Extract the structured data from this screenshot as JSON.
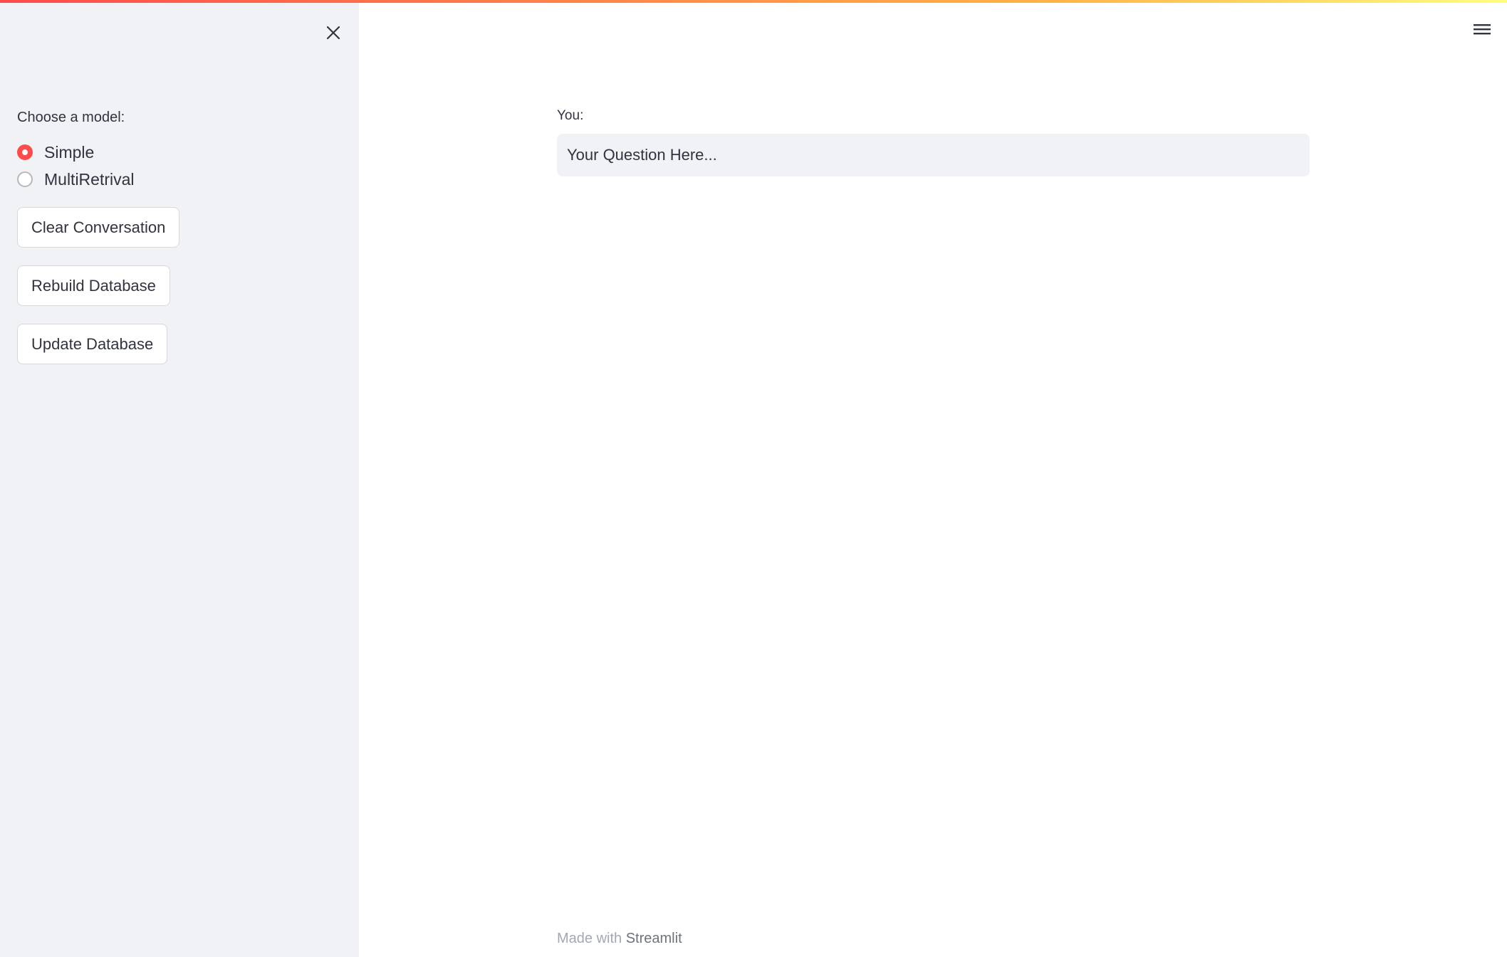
{
  "sidebar": {
    "model_label": "Choose a model:",
    "model_options": [
      {
        "label": "Simple",
        "selected": true
      },
      {
        "label": "MultiRetrival",
        "selected": false
      }
    ],
    "buttons": {
      "clear": "Clear Conversation",
      "rebuild": "Rebuild Database",
      "update": "Update Database"
    },
    "close_icon": "close-icon"
  },
  "header": {
    "menu_icon": "hamburger-menu-icon"
  },
  "main": {
    "input_label": "You:",
    "input_placeholder": "Your Question Here...",
    "input_value": ""
  },
  "footer": {
    "prefix": "Made with ",
    "brand": "Streamlit"
  },
  "colors": {
    "accent": "#ff4b4b",
    "sidebar_bg": "#f0f2f6",
    "text": "#31333f"
  }
}
